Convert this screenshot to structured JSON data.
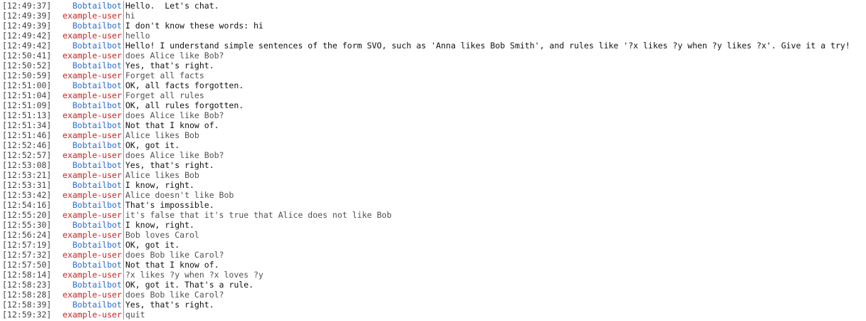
{
  "colors": {
    "bot_nick": "#2a6bd1",
    "user_nick": "#cc2020",
    "bot_text": "#111111",
    "user_text": "#505050",
    "timestamp": "#444444"
  },
  "messages": [
    {
      "time": "[12:49:37]",
      "nick": "Bobtailbot",
      "role": "bot",
      "text": "Hello.  Let's chat."
    },
    {
      "time": "[12:49:39]",
      "nick": "example-user",
      "role": "user",
      "text": "hi"
    },
    {
      "time": "[12:49:39]",
      "nick": "Bobtailbot",
      "role": "bot",
      "text": "I don't know these words: hi"
    },
    {
      "time": "[12:49:42]",
      "nick": "example-user",
      "role": "user",
      "text": "hello"
    },
    {
      "time": "[12:49:42]",
      "nick": "Bobtailbot",
      "role": "bot",
      "text": "Hello! I understand simple sentences of the form SVO, such as 'Anna likes Bob Smith', and rules like '?x likes ?y when ?y likes ?x'. Give it a try!"
    },
    {
      "time": "[12:50:41]",
      "nick": "example-user",
      "role": "user",
      "text": "does Alice like Bob?"
    },
    {
      "time": "[12:50:52]",
      "nick": "Bobtailbot",
      "role": "bot",
      "text": "Yes, that's right."
    },
    {
      "time": "[12:50:59]",
      "nick": "example-user",
      "role": "user",
      "text": "Forget all facts"
    },
    {
      "time": "[12:51:00]",
      "nick": "Bobtailbot",
      "role": "bot",
      "text": "OK, all facts forgotten."
    },
    {
      "time": "[12:51:04]",
      "nick": "example-user",
      "role": "user",
      "text": "Forget all rules"
    },
    {
      "time": "[12:51:09]",
      "nick": "Bobtailbot",
      "role": "bot",
      "text": "OK, all rules forgotten."
    },
    {
      "time": "[12:51:13]",
      "nick": "example-user",
      "role": "user",
      "text": "does Alice like Bob?"
    },
    {
      "time": "[12:51:34]",
      "nick": "Bobtailbot",
      "role": "bot",
      "text": "Not that I know of."
    },
    {
      "time": "[12:51:46]",
      "nick": "example-user",
      "role": "user",
      "text": "Alice likes Bob"
    },
    {
      "time": "[12:52:46]",
      "nick": "Bobtailbot",
      "role": "bot",
      "text": "OK, got it."
    },
    {
      "time": "[12:52:57]",
      "nick": "example-user",
      "role": "user",
      "text": "does Alice like Bob?"
    },
    {
      "time": "[12:53:08]",
      "nick": "Bobtailbot",
      "role": "bot",
      "text": "Yes, that's right."
    },
    {
      "time": "[12:53:21]",
      "nick": "example-user",
      "role": "user",
      "text": "Alice likes Bob"
    },
    {
      "time": "[12:53:31]",
      "nick": "Bobtailbot",
      "role": "bot",
      "text": "I know, right."
    },
    {
      "time": "[12:53:42]",
      "nick": "example-user",
      "role": "user",
      "text": "Alice doesn't like Bob"
    },
    {
      "time": "[12:54:16]",
      "nick": "Bobtailbot",
      "role": "bot",
      "text": "That's impossible."
    },
    {
      "time": "[12:55:20]",
      "nick": "example-user",
      "role": "user",
      "text": "it's false that it's true that Alice does not like Bob"
    },
    {
      "time": "[12:55:30]",
      "nick": "Bobtailbot",
      "role": "bot",
      "text": "I know, right."
    },
    {
      "time": "[12:56:24]",
      "nick": "example-user",
      "role": "user",
      "text": "Bob loves Carol"
    },
    {
      "time": "[12:57:19]",
      "nick": "Bobtailbot",
      "role": "bot",
      "text": "OK, got it."
    },
    {
      "time": "[12:57:32]",
      "nick": "example-user",
      "role": "user",
      "text": "does Bob like Carol?"
    },
    {
      "time": "[12:57:50]",
      "nick": "Bobtailbot",
      "role": "bot",
      "text": "Not that I know of."
    },
    {
      "time": "[12:58:14]",
      "nick": "example-user",
      "role": "user",
      "text": "?x likes ?y when ?x loves ?y"
    },
    {
      "time": "[12:58:23]",
      "nick": "Bobtailbot",
      "role": "bot",
      "text": "OK, got it. That's a rule."
    },
    {
      "time": "[12:58:28]",
      "nick": "example-user",
      "role": "user",
      "text": "does Bob like Carol?"
    },
    {
      "time": "[12:58:39]",
      "nick": "Bobtailbot",
      "role": "bot",
      "text": "Yes, that's right."
    },
    {
      "time": "[12:59:32]",
      "nick": "example-user",
      "role": "user",
      "text": "quit"
    }
  ]
}
